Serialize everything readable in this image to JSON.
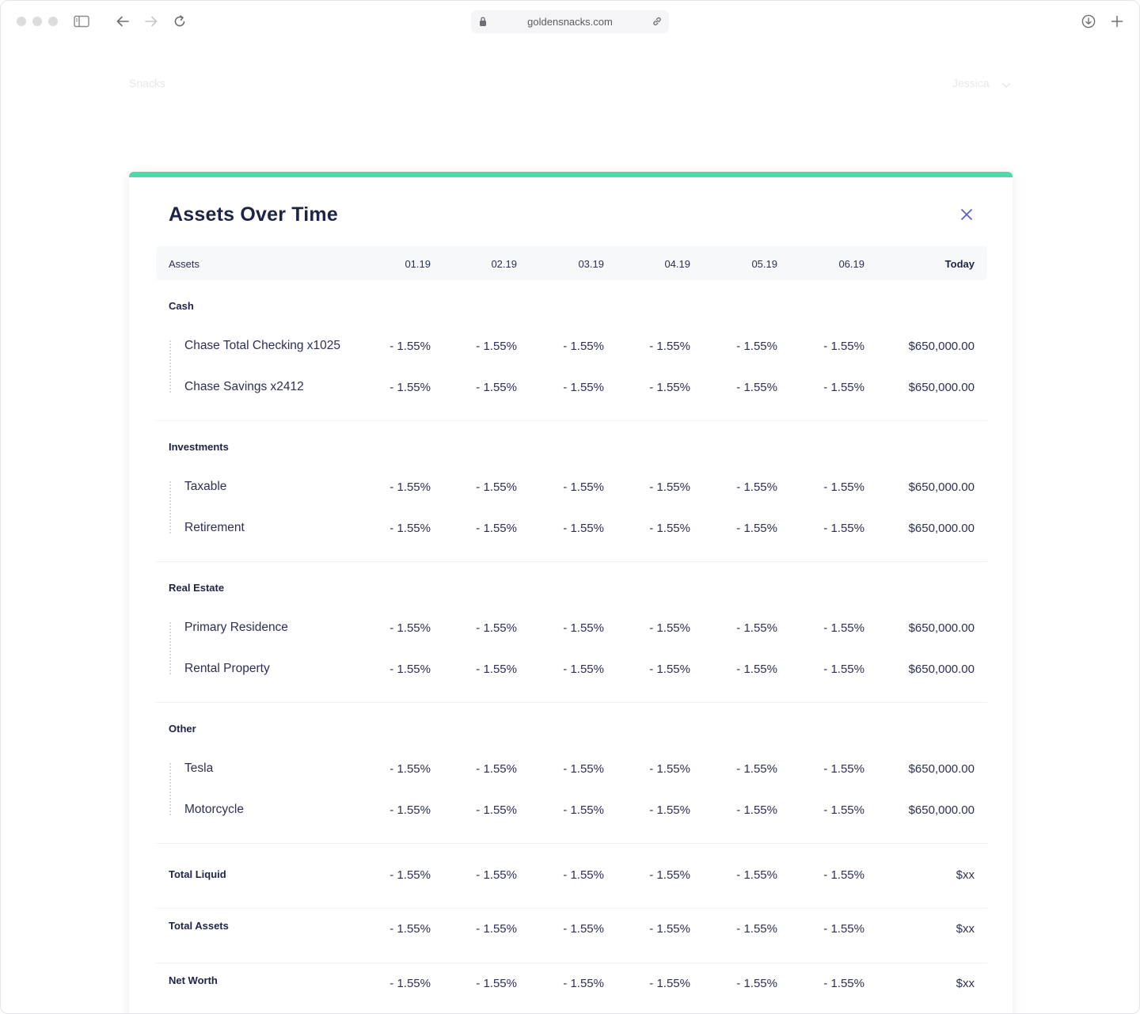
{
  "browser": {
    "url": "goldensnacks.com"
  },
  "page": {
    "brand": "Snacks",
    "user": "Jessica"
  },
  "modal": {
    "title": "Assets Over Time",
    "accent_color": "#52d7a8",
    "columns": [
      "Assets",
      "01.19",
      "02.19",
      "03.19",
      "04.19",
      "05.19",
      "06.19",
      "Today"
    ],
    "groups": [
      {
        "name": "Cash",
        "rows": [
          {
            "label": "Chase Total Checking x1025",
            "values": [
              "- 1.55%",
              "- 1.55%",
              "- 1.55%",
              "- 1.55%",
              "- 1.55%",
              "- 1.55%"
            ],
            "today": "$650,000.00"
          },
          {
            "label": "Chase Savings x2412",
            "values": [
              "- 1.55%",
              "- 1.55%",
              "- 1.55%",
              "- 1.55%",
              "- 1.55%",
              "- 1.55%"
            ],
            "today": "$650,000.00"
          }
        ]
      },
      {
        "name": "Investments",
        "rows": [
          {
            "label": "Taxable",
            "values": [
              "- 1.55%",
              "- 1.55%",
              "- 1.55%",
              "- 1.55%",
              "- 1.55%",
              "- 1.55%"
            ],
            "today": "$650,000.00"
          },
          {
            "label": "Retirement",
            "values": [
              "- 1.55%",
              "- 1.55%",
              "- 1.55%",
              "- 1.55%",
              "- 1.55%",
              "- 1.55%"
            ],
            "today": "$650,000.00"
          }
        ]
      },
      {
        "name": "Real Estate",
        "rows": [
          {
            "label": "Primary Residence",
            "values": [
              "- 1.55%",
              "- 1.55%",
              "- 1.55%",
              "- 1.55%",
              "- 1.55%",
              "- 1.55%"
            ],
            "today": "$650,000.00"
          },
          {
            "label": "Rental Property",
            "values": [
              "- 1.55%",
              "- 1.55%",
              "- 1.55%",
              "- 1.55%",
              "- 1.55%",
              "- 1.55%"
            ],
            "today": "$650,000.00"
          }
        ]
      },
      {
        "name": "Other",
        "rows": [
          {
            "label": "Tesla",
            "values": [
              "- 1.55%",
              "- 1.55%",
              "- 1.55%",
              "- 1.55%",
              "- 1.55%",
              "- 1.55%"
            ],
            "today": "$650,000.00"
          },
          {
            "label": "Motorcycle",
            "values": [
              "- 1.55%",
              "- 1.55%",
              "- 1.55%",
              "- 1.55%",
              "- 1.55%",
              "- 1.55%"
            ],
            "today": "$650,000.00"
          }
        ]
      }
    ],
    "totals": [
      {
        "label": "Total Liquid",
        "values": [
          "- 1.55%",
          "- 1.55%",
          "- 1.55%",
          "- 1.55%",
          "- 1.55%",
          "- 1.55%"
        ],
        "today": "$xx"
      },
      {
        "label": "Total Assets",
        "values": [
          "- 1.55%",
          "- 1.55%",
          "- 1.55%",
          "- 1.55%",
          "- 1.55%",
          "- 1.55%"
        ],
        "today": "$xx"
      },
      {
        "label": "Net Worth",
        "values": [
          "- 1.55%",
          "- 1.55%",
          "- 1.55%",
          "- 1.55%",
          "- 1.55%",
          "- 1.55%"
        ],
        "today": "$xx"
      }
    ]
  }
}
